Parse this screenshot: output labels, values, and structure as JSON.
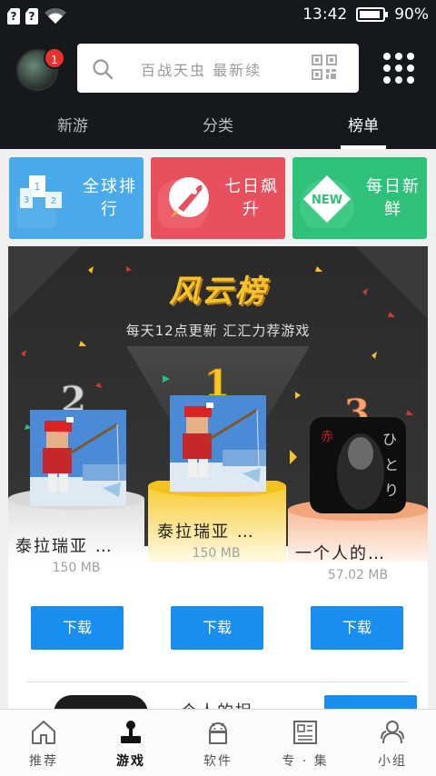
{
  "status_bar": {
    "sim1": "?",
    "sim2": "?",
    "time": "13:42",
    "battery": "90%",
    "battery_level": 0.9
  },
  "header": {
    "notification_count": "1",
    "search_placeholder": "百战天虫 最新续",
    "tabs": [
      {
        "label": "新游",
        "active": false
      },
      {
        "label": "分类",
        "active": false
      },
      {
        "label": "榜单",
        "active": true
      }
    ]
  },
  "categories": [
    {
      "label": "全球排行",
      "color": "#4aa9e8",
      "icon": "podium-icon"
    },
    {
      "label": "七日飙升",
      "color": "#e8505e",
      "icon": "rocket-icon"
    },
    {
      "label": "每日新鲜",
      "color": "#2fc07a",
      "icon": "new-badge-icon"
    }
  ],
  "board": {
    "title": "风云榜",
    "subtitle": "每天12点更新 汇汇力荐游戏",
    "entries": [
      {
        "rank": "2",
        "name": "泰拉瑞亚 …",
        "size": "150 MB",
        "button": "下载"
      },
      {
        "rank": "1",
        "name": "泰拉瑞亚 …",
        "size": "150 MB",
        "button": "下载"
      },
      {
        "rank": "3",
        "name": "一个人的…",
        "size": "57.02 MB",
        "button": "下载"
      }
    ],
    "next_item_title": "一个人的捉"
  },
  "bottom_nav": [
    {
      "label": "推荐",
      "icon": "home-icon",
      "active": false
    },
    {
      "label": "游戏",
      "icon": "joystick-icon",
      "active": true
    },
    {
      "label": "软件",
      "icon": "android-icon",
      "active": false
    },
    {
      "label": "专 · 集",
      "icon": "newspaper-icon",
      "active": false
    },
    {
      "label": "小组",
      "icon": "group-icon",
      "active": false
    }
  ],
  "colors": {
    "header_bg": "#15191d",
    "accent_blue": "#1a8ef0",
    "badge_red": "#e8312f"
  }
}
